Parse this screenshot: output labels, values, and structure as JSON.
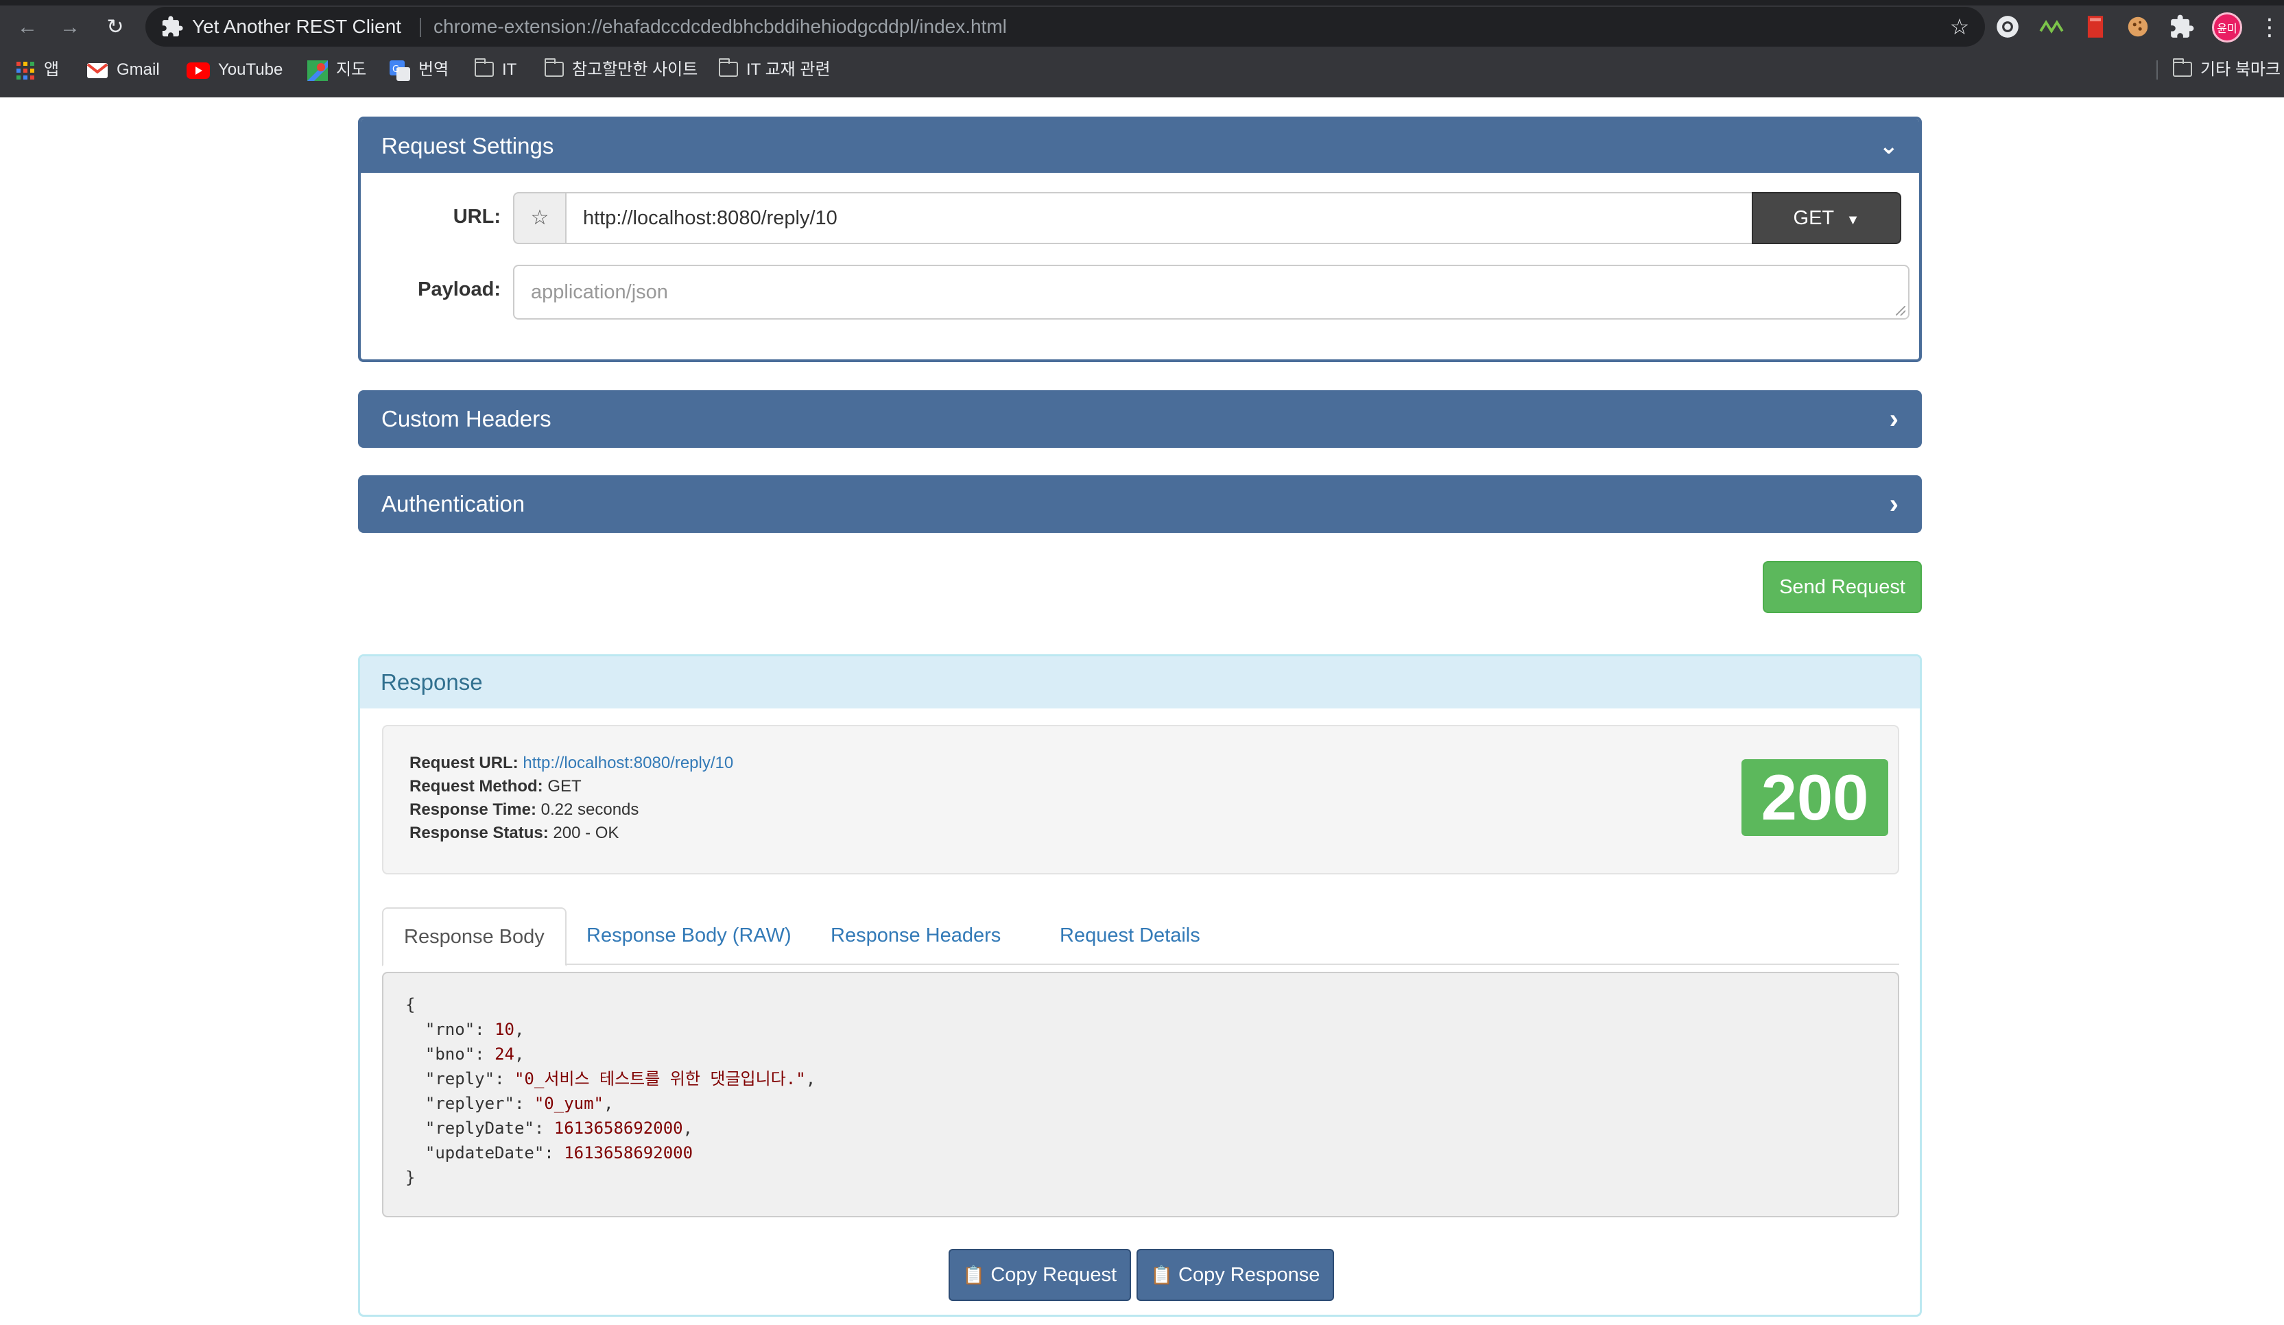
{
  "browser": {
    "tab_title": "Yet Another REST Client",
    "address_url": "chrome-extension://ehafadccdcdedbhcbddihehiodgcddpl/index.html",
    "profile_initials": "윤미",
    "bookmarks": [
      {
        "label": "앱",
        "icon": "apps-grid-icon"
      },
      {
        "label": "Gmail",
        "icon": "gmail-icon"
      },
      {
        "label": "YouTube",
        "icon": "youtube-icon"
      },
      {
        "label": "지도",
        "icon": "maps-icon"
      },
      {
        "label": "번역",
        "icon": "translate-icon"
      },
      {
        "label": "IT",
        "icon": "folder-icon"
      },
      {
        "label": "참고할만한 사이트",
        "icon": "folder-icon"
      },
      {
        "label": "IT 교재 관련",
        "icon": "folder-icon"
      }
    ],
    "other_bookmarks": "기타 북마크"
  },
  "request_settings": {
    "title": "Request Settings",
    "url_label": "URL:",
    "url_value": "http://localhost:8080/reply/10",
    "method": "GET",
    "payload_label": "Payload:",
    "payload_placeholder": "application/json"
  },
  "custom_headers": {
    "title": "Custom Headers"
  },
  "authentication": {
    "title": "Authentication"
  },
  "send_button": "Send Request",
  "response": {
    "title": "Response",
    "request_url_label": "Request URL:",
    "request_url": "http://localhost:8080/reply/10",
    "request_method_label": "Request Method:",
    "request_method": "GET",
    "response_time_label": "Response Time:",
    "response_time": "0.22 seconds",
    "response_status_label": "Response Status:",
    "response_status": "200 - OK",
    "status_code": "200",
    "tabs": [
      "Response Body",
      "Response Body (RAW)",
      "Response Headers",
      "Request Details"
    ],
    "body": {
      "rno": "10",
      "bno": "24",
      "reply": "\"0_서비스 테스트를 위한 댓글입니다.\"",
      "replyer": "\"0_yum\"",
      "replyDate": "1613658692000",
      "updateDate": "1613658692000"
    },
    "copy_request": "Copy Request",
    "copy_response": "Copy Response"
  },
  "colors": {
    "panel_primary": "#4a6d99",
    "success": "#5cb85c",
    "info_bg": "#d9edf7",
    "link": "#337ab7"
  }
}
